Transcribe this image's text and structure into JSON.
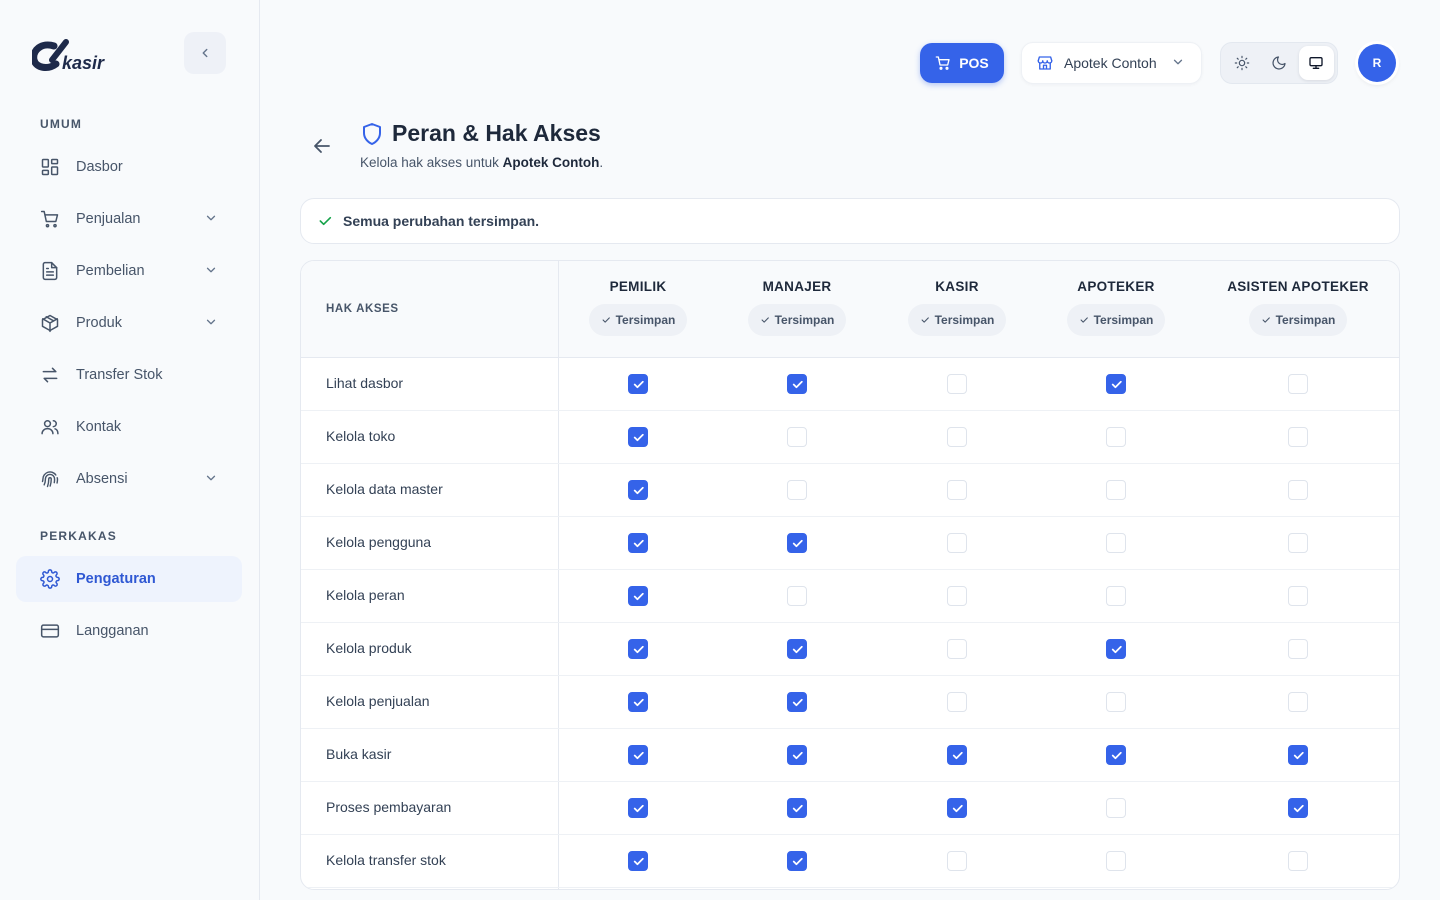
{
  "sidebar": {
    "logo_text": "kasir",
    "sections": [
      {
        "title": "UMUM"
      },
      {
        "title": "PERKAKAS"
      }
    ],
    "items": [
      {
        "label": "Dasbor"
      },
      {
        "label": "Penjualan"
      },
      {
        "label": "Pembelian"
      },
      {
        "label": "Produk"
      },
      {
        "label": "Transfer Stok"
      },
      {
        "label": "Kontak"
      },
      {
        "label": "Absensi"
      },
      {
        "label": "Pengaturan"
      },
      {
        "label": "Langganan"
      }
    ]
  },
  "topbar": {
    "pos_label": "POS",
    "store_name": "Apotek Contoh",
    "avatar_initial": "R"
  },
  "header": {
    "title": "Peran & Hak Akses",
    "subtitle_prefix": "Kelola hak akses untuk ",
    "subtitle_store": "Apotek Contoh",
    "subtitle_suffix": "."
  },
  "alert": {
    "message": "Semua perubahan tersimpan."
  },
  "table": {
    "permission_header": "HAK AKSES",
    "roles": [
      {
        "name": "PEMILIK",
        "status": "Tersimpan"
      },
      {
        "name": "MANAJER",
        "status": "Tersimpan"
      },
      {
        "name": "KASIR",
        "status": "Tersimpan"
      },
      {
        "name": "APOTEKER",
        "status": "Tersimpan"
      },
      {
        "name": "ASISTEN APOTEKER",
        "status": "Tersimpan"
      }
    ],
    "rows": [
      {
        "label": "Lihat dasbor",
        "checks": [
          true,
          true,
          false,
          true,
          false
        ]
      },
      {
        "label": "Kelola toko",
        "checks": [
          true,
          false,
          false,
          false,
          false
        ]
      },
      {
        "label": "Kelola data master",
        "checks": [
          true,
          false,
          false,
          false,
          false
        ]
      },
      {
        "label": "Kelola pengguna",
        "checks": [
          true,
          true,
          false,
          false,
          false
        ]
      },
      {
        "label": "Kelola peran",
        "checks": [
          true,
          false,
          false,
          false,
          false
        ]
      },
      {
        "label": "Kelola produk",
        "checks": [
          true,
          true,
          false,
          true,
          false
        ]
      },
      {
        "label": "Kelola penjualan",
        "checks": [
          true,
          true,
          false,
          false,
          false
        ]
      },
      {
        "label": "Buka kasir",
        "checks": [
          true,
          true,
          true,
          true,
          true
        ]
      },
      {
        "label": "Proses pembayaran",
        "checks": [
          true,
          true,
          true,
          false,
          true
        ]
      },
      {
        "label": "Kelola transfer stok",
        "checks": [
          true,
          true,
          false,
          false,
          false
        ]
      }
    ]
  },
  "colors": {
    "accent": "#3563e9",
    "success": "#16a34a"
  }
}
